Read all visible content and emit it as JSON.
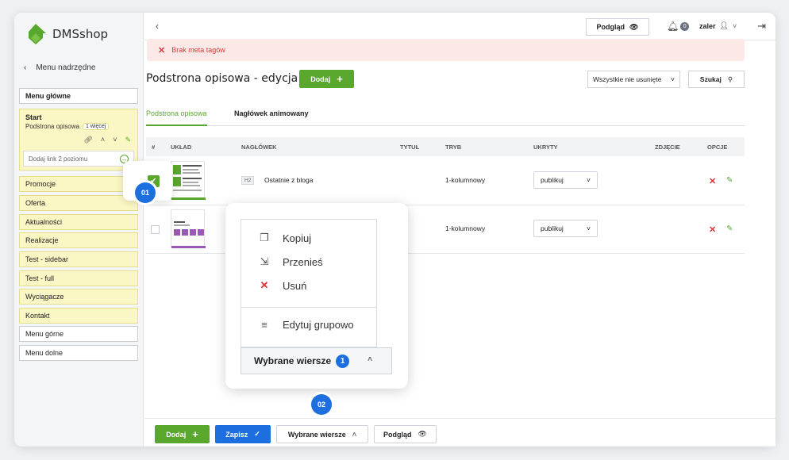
{
  "app": {
    "name": "DMSshop"
  },
  "sidebar": {
    "back_label": "Menu nadrzędne",
    "main_menu": "Menu główne",
    "start": {
      "title": "Start",
      "subtitle": "Podstrona opisowa",
      "more_badge": "1 więcej",
      "add_link_placeholder": "Dodaj link 2 poziomu"
    },
    "items": [
      "Promocje",
      "Oferta",
      "Aktualności",
      "Realizacje",
      "Test - sidebar",
      "Test - full",
      "Wyciągacze",
      "Kontakt"
    ],
    "bottom_items": [
      "Menu górne",
      "Menu dolne"
    ]
  },
  "topbar": {
    "preview_label": "Podgląd",
    "notification_count": "0",
    "username": "zaler"
  },
  "alert": {
    "message": "Brak meta tagów"
  },
  "page": {
    "title": "Podstrona opisowa - edycja (2)",
    "add_label": "Dodaj",
    "filter_value": "Wszystkie nie usunięte",
    "search_label": "Szukaj"
  },
  "tabs": [
    "Podstrona opisowa",
    "Nagłówek animowany"
  ],
  "table": {
    "columns": [
      "#",
      "UKŁAD",
      "NAGŁÓWEK",
      "TYTUŁ",
      "TRYB",
      "UKRYTY",
      "ZDJĘCIE",
      "OPCJE"
    ],
    "rows": [
      {
        "checked": true,
        "heading_tag": "H2",
        "heading": "Ostatnie z bloga",
        "title": "",
        "mode": "1-kolumnowy",
        "hidden": "publikuj"
      },
      {
        "checked": false,
        "heading_tag": "",
        "heading": "",
        "title": "",
        "mode": "1-kolumnowy",
        "hidden": "publikuj"
      }
    ]
  },
  "steps": {
    "first": "01",
    "second": "02"
  },
  "popup": {
    "actions": [
      {
        "label": "Kopiuj",
        "icon": "copy-icon"
      },
      {
        "label": "Przenieś",
        "icon": "move-icon"
      },
      {
        "label": "Usuń",
        "icon": "delete-icon"
      }
    ],
    "group_edit": {
      "label": "Edytuj grupowo",
      "icon": "edit-list-icon"
    },
    "selected_rows_label": "Wybrane wiersze",
    "selected_count": "1"
  },
  "bottombar": {
    "add_label": "Dodaj",
    "save_label": "Zapisz",
    "selected_rows_label": "Wybrane wiersze",
    "preview_label": "Podgląd"
  },
  "colors": {
    "green": "#5aa72e",
    "blue": "#1d6fe0",
    "red": "#e03131",
    "highlight": "#fbf7c4"
  }
}
